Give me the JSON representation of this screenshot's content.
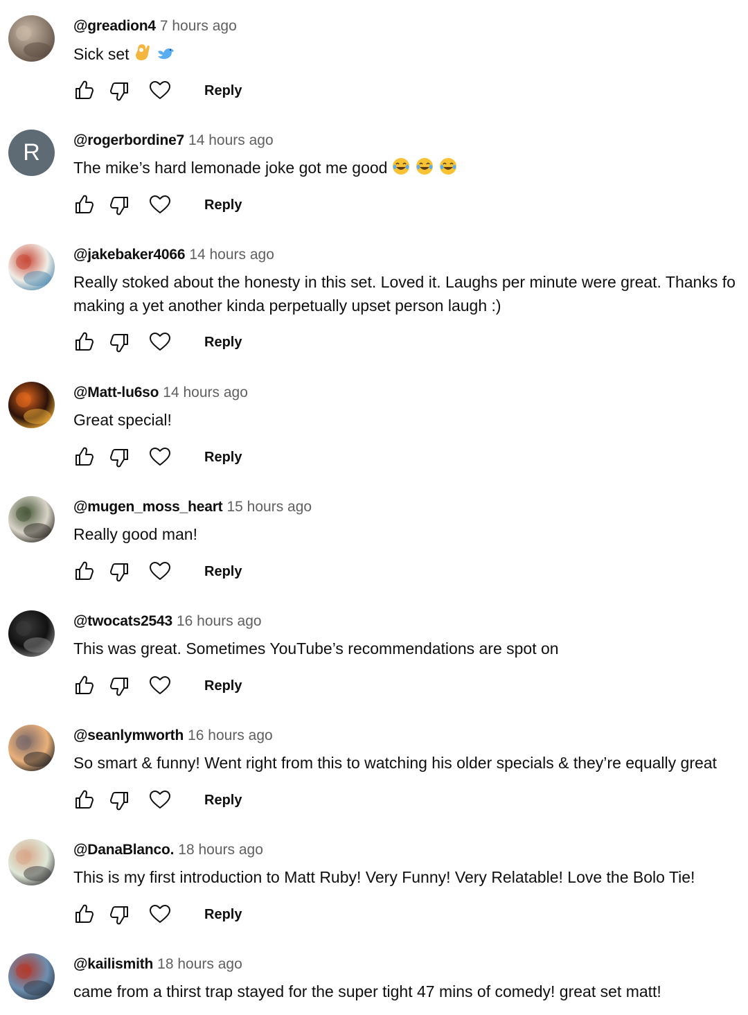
{
  "comments": [
    {
      "author": "@greadion4",
      "time": "7 hours ago",
      "lines": [
        "Sick set"
      ],
      "emojis": [
        "ok-hand-emoji",
        "bird-emoji"
      ],
      "avatar": {
        "type": "photo",
        "colors": [
          "#8a7a6c",
          "#c9b8a6",
          "#5a4a3f"
        ]
      },
      "reply": "Reply"
    },
    {
      "author": "@rogerbordine7",
      "time": "14 hours ago",
      "lines": [
        "The mike’s hard lemonade joke got me good"
      ],
      "emojis": [
        "laughing-tears-emoji",
        "laughing-tears-emoji",
        "laughing-tears-emoji"
      ],
      "avatar": {
        "type": "letter",
        "letter": "R",
        "colors": [
          "#5f6b74"
        ]
      },
      "reply": "Reply"
    },
    {
      "author": "@jakebaker4066",
      "time": "14 hours ago",
      "lines": [
        "Really stoked about the honesty in this set. Loved it. Laughs per minute were great. Thanks fo",
        "making a yet another kinda perpetually upset person laugh :)"
      ],
      "emojis": [],
      "avatar": {
        "type": "photo",
        "colors": [
          "#f1ede6",
          "#c94b3a",
          "#4d8ab0"
        ]
      },
      "reply": "Reply"
    },
    {
      "author": "@Matt-lu6so",
      "time": "14 hours ago",
      "lines": [
        "Great special!"
      ],
      "emojis": [],
      "avatar": {
        "type": "photo",
        "colors": [
          "#2a120a",
          "#e0661e",
          "#f6b23a"
        ]
      },
      "reply": "Reply"
    },
    {
      "author": "@mugen_moss_heart",
      "time": "15 hours ago",
      "lines": [
        "Really good man!"
      ],
      "emojis": [],
      "avatar": {
        "type": "photo",
        "colors": [
          "#d8d4c8",
          "#4b5a3c",
          "#2e2a24"
        ]
      },
      "reply": "Reply"
    },
    {
      "author": "@twocats2543",
      "time": "16 hours ago",
      "lines": [
        "This was great. Sometimes YouTube’s recommendations are spot on"
      ],
      "emojis": [],
      "avatar": {
        "type": "photo",
        "colors": [
          "#111111",
          "#3a3a3a",
          "#8a8a8a"
        ]
      },
      "reply": "Reply"
    },
    {
      "author": "@seanlymworth",
      "time": "16 hours ago",
      "lines": [
        "So smart & funny! Went right from this to watching his older specials & they’re equally great"
      ],
      "emojis": [],
      "avatar": {
        "type": "photo",
        "colors": [
          "#e9b07a",
          "#7b6a6a",
          "#1f1f22"
        ]
      },
      "reply": "Reply"
    },
    {
      "author": "@DanaBlanco.",
      "time": "18 hours ago",
      "lines": [
        "This is my first introduction to Matt Ruby!  Very Funny!  Very Relatable!  Love the Bolo Tie!"
      ],
      "emojis": [],
      "avatar": {
        "type": "photo",
        "colors": [
          "#dfe7d8",
          "#d8a88a",
          "#3c3c3c"
        ]
      },
      "reply": "Reply"
    },
    {
      "author": "@kailismith",
      "time": "18 hours ago",
      "lines": [
        "came from a thirst trap stayed for the super tight 47 mins of comedy! great set matt!"
      ],
      "emojis": [],
      "avatar": {
        "type": "photo",
        "colors": [
          "#6d8fb0",
          "#b23a2e",
          "#2d3a4a"
        ]
      },
      "reply": "Reply"
    }
  ],
  "icons": {
    "like": "thumbs-up-icon",
    "dislike": "thumbs-down-icon",
    "heart": "heart-icon"
  },
  "colors": {
    "author": "#0f0f0f",
    "time": "#606060",
    "text": "#0f0f0f"
  }
}
